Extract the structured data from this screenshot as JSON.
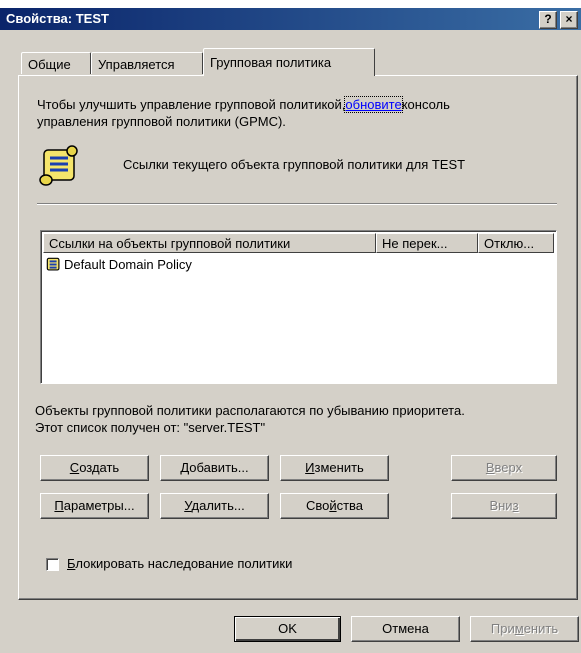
{
  "window": {
    "title": "Свойства: TEST",
    "help_label": "?",
    "close_label": "×"
  },
  "tabs": [
    {
      "label": "Общие",
      "active": false
    },
    {
      "label": "Управляется",
      "active": false
    },
    {
      "label": "Групповая политика",
      "active": true
    }
  ],
  "info": {
    "text_before_link": "Чтобы улучшить управление групповой политикой,",
    "link_text": "обновите",
    "text_after_link": "консоль",
    "line2": "управления групповой политики (GPMC)."
  },
  "links_title": "Ссылки текущего объекта групповой политики для TEST",
  "list": {
    "columns": [
      "Ссылки на объекты групповой политики",
      "Не перек...",
      "Отклю..."
    ],
    "rows": [
      {
        "name": "Default Domain Policy",
        "icon": "gpo-scroll-icon"
      }
    ]
  },
  "priority_note": {
    "line1": "Объекты групповой политики располагаются по убыванию приоритета.",
    "line2": "Этот список получен от: \"server.TEST\""
  },
  "buttons": {
    "create": {
      "pre": "",
      "accel": "С",
      "post": "оздать"
    },
    "add": {
      "pre": "",
      "accel": "Д",
      "post": "обавить..."
    },
    "edit": {
      "pre": "",
      "accel": "И",
      "post": "зменить"
    },
    "up": {
      "pre": "",
      "accel": "В",
      "post": "верх"
    },
    "options": {
      "pre": "",
      "accel": "П",
      "post": "араметры..."
    },
    "delete": {
      "pre": "",
      "accel": "У",
      "post": "далить..."
    },
    "properties": {
      "pre": "Сво",
      "accel": "й",
      "post": "ства"
    },
    "down": {
      "pre": "Вни",
      "accel": "з",
      "post": ""
    }
  },
  "block_inheritance": {
    "pre": "",
    "accel": "Б",
    "post": "локировать наследование политики",
    "checked": false
  },
  "footer": {
    "ok": "OK",
    "cancel": "Отмена",
    "apply": {
      "pre": "При",
      "accel": "м",
      "post": "енить"
    }
  }
}
